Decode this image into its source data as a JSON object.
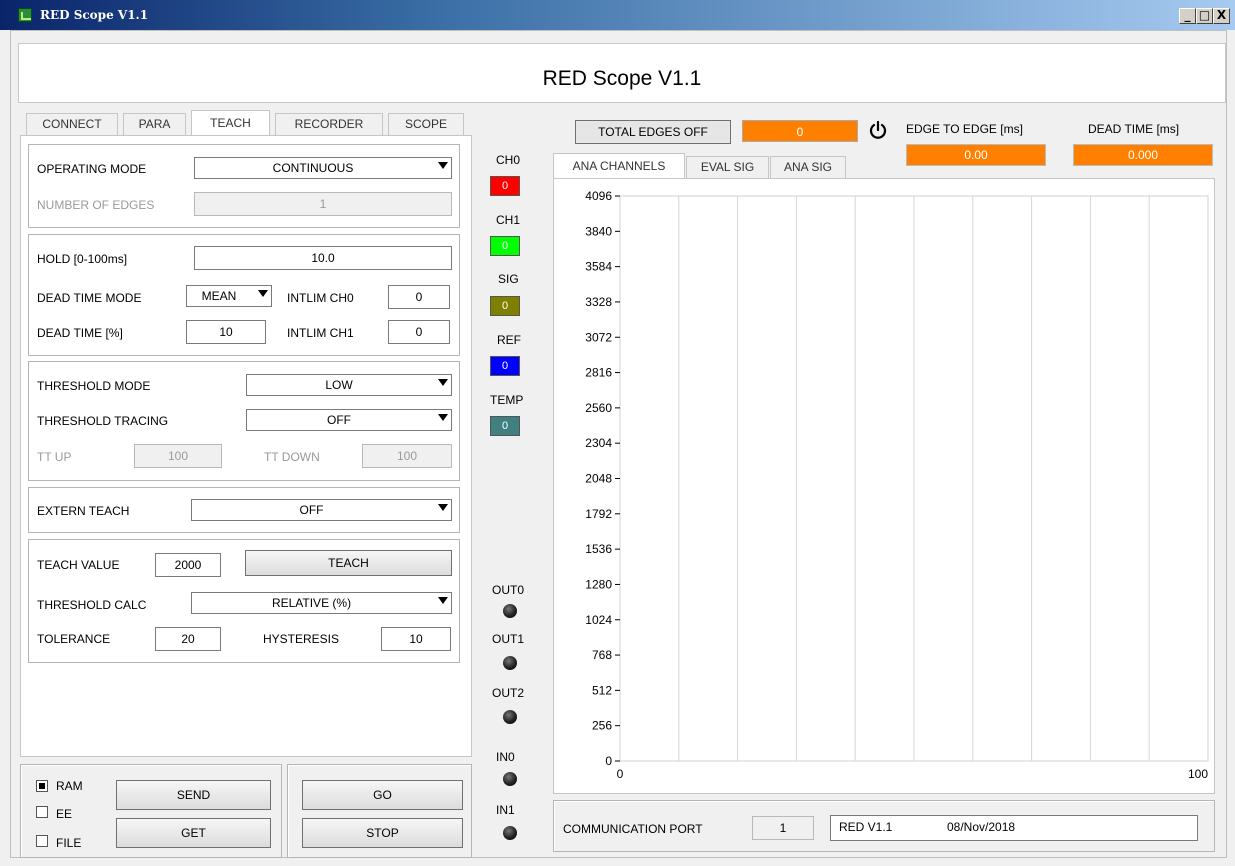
{
  "window": {
    "title": "RED Scope V1.1",
    "minimize": "_",
    "maximize": "□",
    "close": "X"
  },
  "header": {
    "title": "RED Scope V1.1"
  },
  "tabs": [
    "CONNECT",
    "PARA",
    "TEACH",
    "RECORDER",
    "SCOPE"
  ],
  "operating": {
    "mode_label": "OPERATING MODE",
    "mode_value": "CONTINUOUS",
    "edges_label": "NUMBER OF EDGES",
    "edges_value": "1"
  },
  "hold": {
    "hold_label": "HOLD [0-100ms]",
    "hold_value": "10.0",
    "dtm_label": "DEAD TIME MODE",
    "dtm_value": "MEAN",
    "intlim0_label": "INTLIM CH0",
    "intlim0_value": "0",
    "dt_label": "DEAD TIME [%]",
    "dt_value": "10",
    "intlim1_label": "INTLIM CH1",
    "intlim1_value": "0"
  },
  "threshold": {
    "mode_label": "THRESHOLD MODE",
    "mode_value": "LOW",
    "tracing_label": "THRESHOLD TRACING",
    "tracing_value": "OFF",
    "ttup_label": "TT UP",
    "ttup_value": "100",
    "ttdown_label": "TT DOWN",
    "ttdown_value": "100"
  },
  "extern": {
    "label": "EXTERN TEACH",
    "value": "OFF"
  },
  "teach": {
    "value_label": "TEACH VALUE",
    "value": "2000",
    "button": "TEACH",
    "calc_label": "THRESHOLD CALC",
    "calc_value": "RELATIVE (%)",
    "tol_label": "TOLERANCE",
    "tol_value": "20",
    "hyst_label": "HYSTERESIS",
    "hyst_value": "10"
  },
  "bottom": {
    "ram": "RAM",
    "ee": "EE",
    "file": "FILE",
    "send": "SEND",
    "get": "GET",
    "go": "GO",
    "stop": "STOP"
  },
  "channels": [
    {
      "label": "CH0",
      "value": "0",
      "color": "#ff0000"
    },
    {
      "label": "CH1",
      "value": "0",
      "color": "#00ff00"
    },
    {
      "label": "SIG",
      "value": "0",
      "color": "#808000"
    },
    {
      "label": "REF",
      "value": "0",
      "color": "#0000ff"
    },
    {
      "label": "TEMP",
      "value": "0",
      "color": "#408080"
    }
  ],
  "io": [
    "OUT0",
    "OUT1",
    "OUT2",
    "IN0",
    "IN1"
  ],
  "scope_header": {
    "total_edges": "TOTAL EDGES OFF",
    "total_value": "0",
    "e2e_label": "EDGE TO EDGE [ms]",
    "e2e_value": "0.00",
    "dead_label": "DEAD TIME [ms]",
    "dead_value": "0.000"
  },
  "chart_tabs": [
    "ANA CHANNELS",
    "EVAL SIG",
    "ANA SIG"
  ],
  "chart_data": {
    "type": "line",
    "series": [],
    "xlim": [
      0,
      100
    ],
    "ylim": [
      0,
      4096
    ],
    "xticks": [
      "0",
      "100"
    ],
    "yticks": [
      "4096",
      "3840",
      "3584",
      "3328",
      "3072",
      "2816",
      "2560",
      "2304",
      "2048",
      "1792",
      "1536",
      "1280",
      "1024",
      "768",
      "512",
      "256",
      "0"
    ],
    "grid": true
  },
  "comm": {
    "label": "COMMUNICATION PORT",
    "port": "1",
    "info_name": "RED V1.1",
    "info_date": "08/Nov/2018"
  }
}
